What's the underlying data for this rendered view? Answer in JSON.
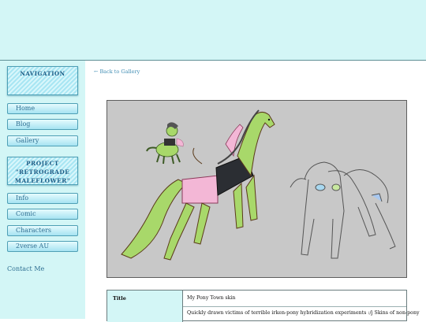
{
  "sidebar": {
    "navigation_heading": "Navigation",
    "nav_items": [
      {
        "label": "Home"
      },
      {
        "label": "Blog"
      },
      {
        "label": "Gallery"
      }
    ],
    "project_heading_line1": "Project",
    "project_heading_line2": "\"Retrograde",
    "project_heading_line3": "Maleflower\"",
    "project_items": [
      {
        "label": "Info"
      },
      {
        "label": "Comic"
      },
      {
        "label": "Characters"
      },
      {
        "label": "2verse AU"
      }
    ],
    "contact_label": "Contact Me"
  },
  "main": {
    "back_link": "← Back to Gallery",
    "info": {
      "title_key": "Title",
      "title_value": "My Pony Town skin",
      "description_value": "Quickly drawn victims of terrible irken-pony hybridization experiments :/j Skins of non-pony"
    }
  },
  "colors": {
    "page_bg": "#ffffff",
    "panel_bg": "#d3f6f6",
    "accent": "#3e8cb3",
    "artwork_bg": "#c8c8c8",
    "pony_green": "#a8d86a",
    "pony_pink": "#f3b7d6"
  }
}
